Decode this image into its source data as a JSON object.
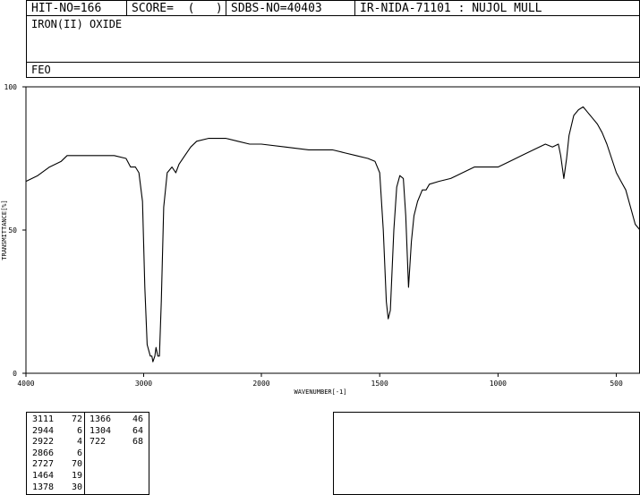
{
  "header": {
    "hit_no": "HIT-NO=166",
    "score": "SCORE=  (   )",
    "sdbs_no": "SDBS-NO=40403",
    "ir_info": "IR-NIDA-71101 : NUJOL MULL"
  },
  "compound_name": "IRON(II) OXIDE",
  "formula": "FEO",
  "peak_table": {
    "col1": [
      {
        "wavenumber": "3111",
        "transmittance": "72"
      },
      {
        "wavenumber": "2944",
        "transmittance": "6"
      },
      {
        "wavenumber": "2922",
        "transmittance": "4"
      },
      {
        "wavenumber": "2866",
        "transmittance": "6"
      },
      {
        "wavenumber": "2727",
        "transmittance": "70"
      },
      {
        "wavenumber": "1464",
        "transmittance": "19"
      },
      {
        "wavenumber": "1378",
        "transmittance": "30"
      }
    ],
    "col2": [
      {
        "wavenumber": "1366",
        "transmittance": "46"
      },
      {
        "wavenumber": "1304",
        "transmittance": "64"
      },
      {
        "wavenumber": "722",
        "transmittance": "68"
      }
    ]
  },
  "chart_data": {
    "type": "line",
    "xlabel": "WAVENUMBER[-1]",
    "ylabel": "TRANSMITTANCE[%]",
    "xlim": [
      4000,
      400
    ],
    "ylim": [
      0,
      100
    ],
    "x_ticks": [
      4000,
      3000,
      2000,
      1500,
      1000,
      500
    ],
    "y_ticks": [
      0,
      50,
      100
    ],
    "line_color": "#000000",
    "series": [
      {
        "points": [
          [
            4000,
            67
          ],
          [
            3900,
            69
          ],
          [
            3800,
            72
          ],
          [
            3700,
            74
          ],
          [
            3650,
            76
          ],
          [
            3550,
            76
          ],
          [
            3400,
            76
          ],
          [
            3250,
            76
          ],
          [
            3150,
            75
          ],
          [
            3111,
            72
          ],
          [
            3070,
            72
          ],
          [
            3040,
            70
          ],
          [
            3010,
            60
          ],
          [
            2990,
            30
          ],
          [
            2970,
            10
          ],
          [
            2944,
            6
          ],
          [
            2930,
            6
          ],
          [
            2922,
            4
          ],
          [
            2905,
            6
          ],
          [
            2895,
            9
          ],
          [
            2880,
            6
          ],
          [
            2866,
            6
          ],
          [
            2850,
            25
          ],
          [
            2830,
            58
          ],
          [
            2800,
            70
          ],
          [
            2760,
            72
          ],
          [
            2727,
            70
          ],
          [
            2700,
            73
          ],
          [
            2650,
            76
          ],
          [
            2600,
            79
          ],
          [
            2550,
            81
          ],
          [
            2450,
            82
          ],
          [
            2300,
            82
          ],
          [
            2200,
            81
          ],
          [
            2100,
            80
          ],
          [
            2000,
            80
          ],
          [
            1900,
            79
          ],
          [
            1800,
            78
          ],
          [
            1700,
            78
          ],
          [
            1650,
            77
          ],
          [
            1600,
            76
          ],
          [
            1550,
            75
          ],
          [
            1520,
            74
          ],
          [
            1500,
            70
          ],
          [
            1485,
            50
          ],
          [
            1472,
            25
          ],
          [
            1464,
            19
          ],
          [
            1455,
            22
          ],
          [
            1440,
            50
          ],
          [
            1428,
            65
          ],
          [
            1415,
            69
          ],
          [
            1400,
            68
          ],
          [
            1390,
            55
          ],
          [
            1378,
            30
          ],
          [
            1372,
            38
          ],
          [
            1366,
            46
          ],
          [
            1355,
            55
          ],
          [
            1340,
            60
          ],
          [
            1320,
            64
          ],
          [
            1304,
            64
          ],
          [
            1290,
            66
          ],
          [
            1250,
            67
          ],
          [
            1200,
            68
          ],
          [
            1150,
            70
          ],
          [
            1100,
            72
          ],
          [
            1050,
            72
          ],
          [
            1000,
            72
          ],
          [
            950,
            74
          ],
          [
            900,
            76
          ],
          [
            850,
            78
          ],
          [
            800,
            80
          ],
          [
            770,
            79
          ],
          [
            745,
            80
          ],
          [
            735,
            76
          ],
          [
            722,
            68
          ],
          [
            710,
            75
          ],
          [
            700,
            83
          ],
          [
            680,
            90
          ],
          [
            660,
            92
          ],
          [
            640,
            93
          ],
          [
            620,
            91
          ],
          [
            600,
            89
          ],
          [
            580,
            87
          ],
          [
            560,
            84
          ],
          [
            540,
            80
          ],
          [
            520,
            75
          ],
          [
            500,
            70
          ],
          [
            480,
            67
          ],
          [
            460,
            64
          ],
          [
            440,
            58
          ],
          [
            420,
            52
          ],
          [
            400,
            50
          ]
        ]
      }
    ]
  },
  "colors": {
    "background": "#ffffff",
    "border": "#000000",
    "trace": "#000000"
  }
}
